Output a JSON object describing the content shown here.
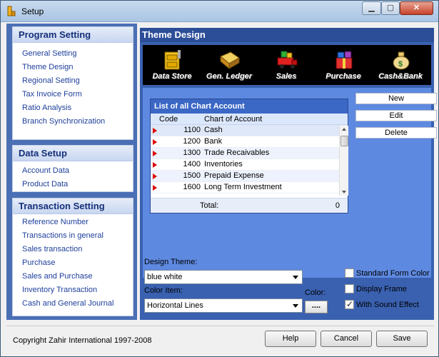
{
  "window": {
    "title": "Setup"
  },
  "sidebar": {
    "program": {
      "heading": "Program Setting",
      "items": [
        "General Setting",
        "Theme Design",
        "Regional Setting",
        "Tax Invoice Form",
        "Ratio Analysis",
        "Branch Synchronization"
      ]
    },
    "data": {
      "heading": "Data Setup",
      "items": [
        "Account Data",
        "Product Data"
      ]
    },
    "transaction": {
      "heading": "Transaction Setting",
      "items": [
        "Reference Number",
        "Transactions in general",
        "Sales transaction",
        "Purchase",
        "Sales and Purchase",
        "Inventory Transaction",
        "Cash and General Journal"
      ]
    }
  },
  "main": {
    "heading": "Theme Design",
    "icons": [
      {
        "label": "Data Store",
        "icon": "file-cabinet-icon"
      },
      {
        "label": "Gen. Ledger",
        "icon": "ledger-book-icon"
      },
      {
        "label": "Sales",
        "icon": "gift-truck-icon"
      },
      {
        "label": "Purchase",
        "icon": "gift-boxes-icon"
      },
      {
        "label": "Cash&Bank",
        "icon": "money-bag-icon"
      }
    ],
    "list": {
      "title": "List of all  Chart  Account",
      "columns": {
        "code": "Code",
        "name": "Chart of Account"
      },
      "rows": [
        {
          "code": "1100",
          "name": "Cash"
        },
        {
          "code": "1200",
          "name": "Bank"
        },
        {
          "code": "1300",
          "name": "Trade Recaivables"
        },
        {
          "code": "1400",
          "name": "Inventories"
        },
        {
          "code": "1500",
          "name": "Prepaid Expense"
        },
        {
          "code": "1600",
          "name": "Long Term Investment"
        }
      ],
      "total_label": "Total:",
      "total_value": "0"
    },
    "buttons": {
      "new": "New",
      "edit": "Edit",
      "delete": "Delete"
    },
    "design_theme": {
      "label": "Design Theme:",
      "value": "blue white"
    },
    "color_item": {
      "label": "Color Item:",
      "value": "Horizontal Lines"
    },
    "color": {
      "label": "Color:",
      "button": "...."
    },
    "options": [
      {
        "label": "Standard Form Color",
        "checked": false
      },
      {
        "label": "Display Frame",
        "checked": false
      },
      {
        "label": "With Sound Effect",
        "checked": true
      }
    ]
  },
  "footer": {
    "copyright": "Copyright Zahir International 1997-2008",
    "help": "Help",
    "cancel": "Cancel",
    "save": "Save"
  }
}
